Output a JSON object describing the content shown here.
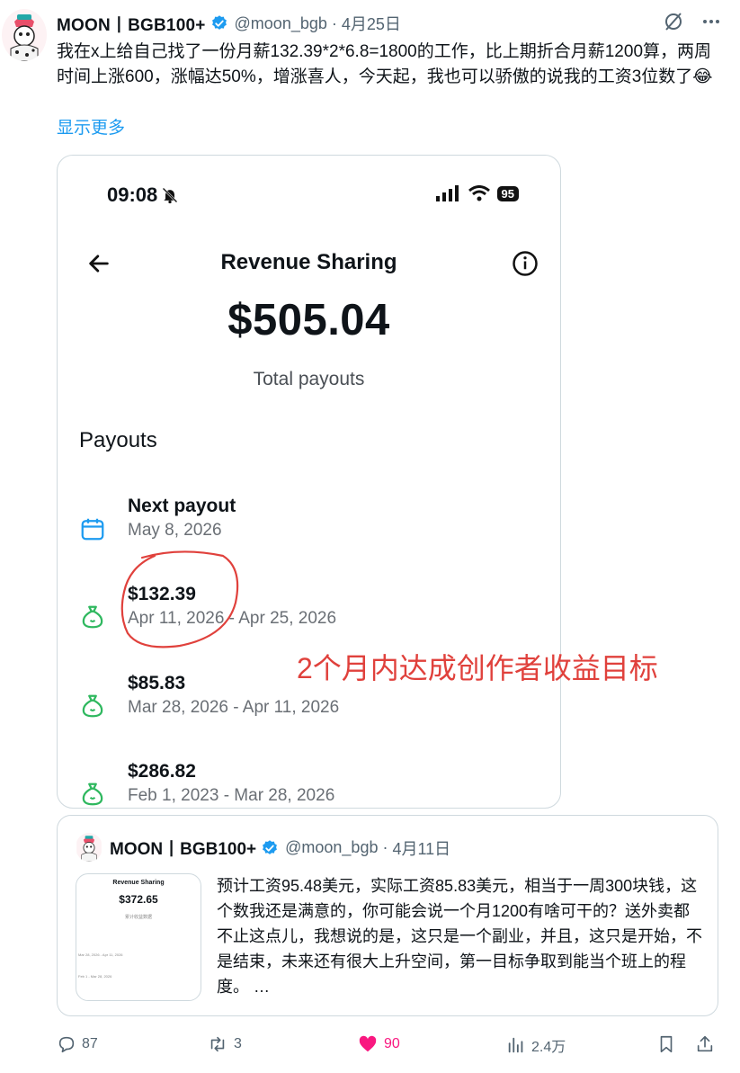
{
  "tweet": {
    "author_name": "MOON丨BGB100+",
    "handle": "@moon_bgb",
    "separator": "·",
    "date": "4月25日",
    "text": "我在x上给自己找了一份月薪132.39*2*6.8=1800的工作，比上期折合月薪1200算，两周时间上涨600，涨幅达50%，增涨喜人，今天起，我也可以骄傲的说我的工资3位数了😂",
    "show_more": "显示更多"
  },
  "phone_screenshot": {
    "status_time": "09:08",
    "battery_level": "95",
    "title": "Revenue Sharing",
    "total_amount": "$505.04",
    "total_label": "Total payouts",
    "payouts_heading": "Payouts",
    "payouts": [
      {
        "title": "Next payout",
        "subtitle": "May 8, 2026",
        "icon": "calendar-icon"
      },
      {
        "title": "$132.39",
        "subtitle": "Apr 11, 2026 - Apr 25, 2026",
        "icon": "money-bag-icon"
      },
      {
        "title": "$85.83",
        "subtitle": "Mar 28, 2026 - Apr 11, 2026",
        "icon": "money-bag-icon"
      },
      {
        "title": "$286.82",
        "subtitle": "Feb 1, 2023 - Mar 28, 2026",
        "icon": "money-bag-icon"
      }
    ],
    "annotation": "2个月内达成创作者收益目标",
    "annotation_color": "#e0413c"
  },
  "quoted_tweet": {
    "author_name": "MOON丨BGB100+",
    "handle": "@moon_bgb",
    "separator": "·",
    "date": "4月11日",
    "text": "预计工资95.48美元，实际工资85.83美元，相当于一周300块钱，这个数我还是满意的，你可能会说一个月1200有啥可干的？送外卖都不止这点儿，我想说的是，这只是一个副业，并且，这只是开始，不是结束，未来还有很大上升空间，第一目标争取到能当个班上的程度。 …",
    "thumbnail": {
      "title": "Revenue Sharing",
      "amount": "$372.65",
      "sub": "累计收益数据",
      "line1": "Mar 28, 2026 - Apr 11, 2026",
      "line2": "Feb 1 - Mar 28, 2026"
    }
  },
  "actions": {
    "reply_count": "87",
    "repost_count": "3",
    "like_count": "90",
    "views_count": "2.4万"
  },
  "colors": {
    "link": "#1d9bf0",
    "like": "#f91880",
    "verified": "#1d9bf0",
    "muted": "#536471"
  }
}
